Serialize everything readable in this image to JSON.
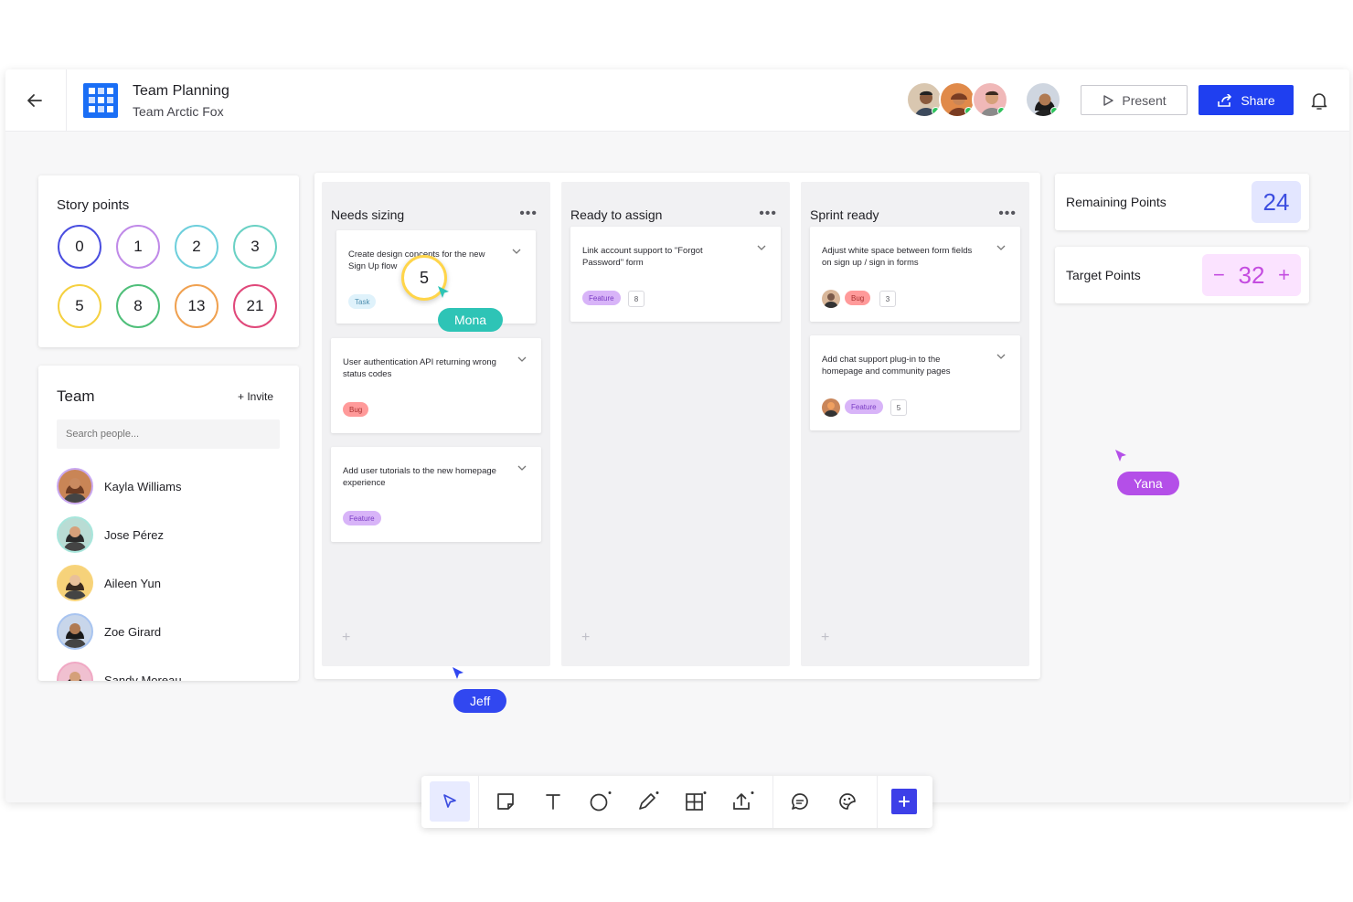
{
  "header": {
    "title": "Team Planning",
    "subtitle": "Team Arctic Fox",
    "present_label": "Present",
    "share_label": "Share"
  },
  "story_points": {
    "title": "Story points",
    "values": [
      "0",
      "1",
      "2",
      "3",
      "5",
      "8",
      "13",
      "21"
    ],
    "colors": [
      "#4a4ee0",
      "#c08ae8",
      "#6ecfdc",
      "#6ad1c4",
      "#f5d040",
      "#4fbf7a",
      "#f0a150",
      "#e0487a"
    ]
  },
  "team": {
    "title": "Team",
    "invite_label": "+ Invite",
    "search_placeholder": "Search people...",
    "members": [
      {
        "name": "Kayla Williams",
        "ring": "#c9a8f0"
      },
      {
        "name": "Jose Pérez",
        "ring": "#a8e6dc"
      },
      {
        "name": "Aileen Yun",
        "ring": "#f8d47a"
      },
      {
        "name": "Zoe Girard",
        "ring": "#a8c4f0"
      },
      {
        "name": "Sandy Moreau",
        "ring": "#f0a8c4"
      }
    ]
  },
  "columns": [
    {
      "title": "Needs sizing",
      "cards": [
        {
          "text": "Create design concepts for the new Sign Up flow",
          "tag": "Task"
        },
        {
          "text": "User authentication API returning wrong status codes",
          "tag": "Bug"
        },
        {
          "text": "Add user tutorials to the new homepage experience",
          "tag": "Feature"
        }
      ]
    },
    {
      "title": "Ready to assign",
      "cards": [
        {
          "text": "Link account support to \"Forgot Password\" form",
          "tag": "Feature",
          "points": "8"
        }
      ]
    },
    {
      "title": "Sprint ready",
      "cards": [
        {
          "text": "Adjust white space between form fields on sign up / sign in forms",
          "tag": "Bug",
          "points": "3"
        },
        {
          "text": "Add chat support plug-in to the homepage and community pages",
          "tag": "Feature",
          "points": "5"
        }
      ]
    }
  ],
  "stats": {
    "remaining_label": "Remaining Points",
    "remaining_value": "24",
    "target_label": "Target Points",
    "target_value": "32",
    "minus": "−",
    "plus": "+"
  },
  "drag": {
    "value": "5"
  },
  "cursors": [
    {
      "name": "Mona",
      "color": "#2ec4b6"
    },
    {
      "name": "Jeff",
      "color": "#3147f0"
    },
    {
      "name": "Yana",
      "color": "#b44fe8"
    }
  ],
  "toolbar": {
    "tools": [
      "select-icon",
      "sticky-note-icon",
      "text-icon",
      "shape-icon",
      "pen-icon",
      "table-icon",
      "upload-icon",
      "comment-icon",
      "sticker-icon",
      "add-icon"
    ]
  },
  "colors": {
    "accent": "#1f3ff0",
    "online": "#2ec45d"
  }
}
